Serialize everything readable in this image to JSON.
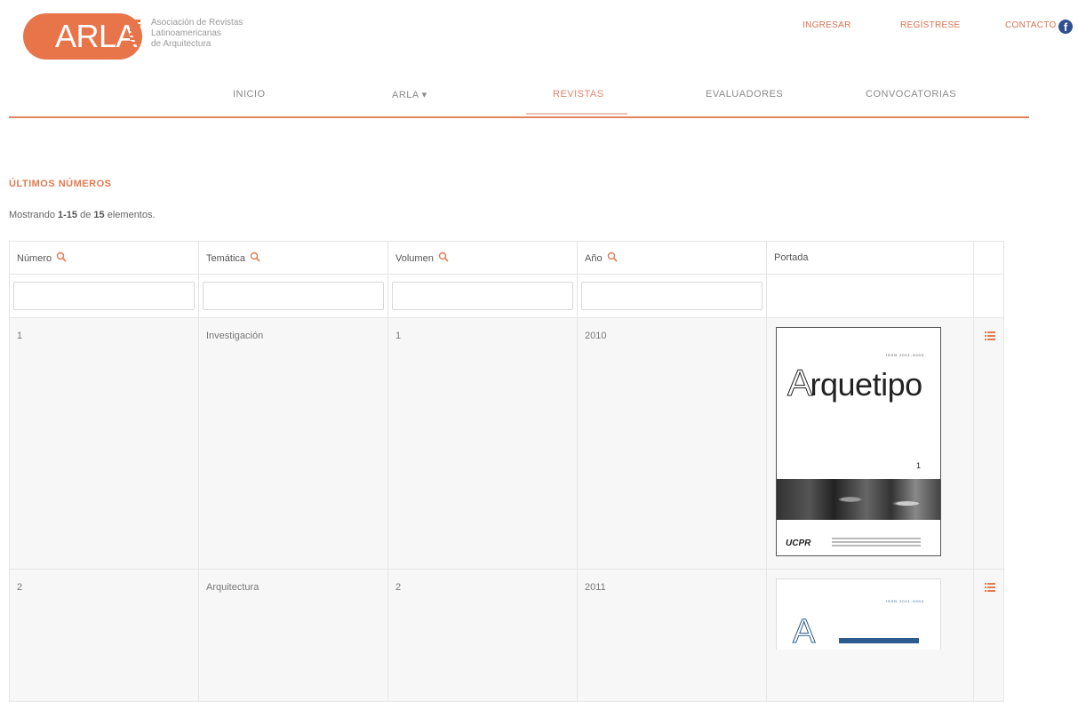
{
  "header": {
    "logo_text": "ARLA",
    "logo_subtitle": "Asociación de Revistas\nLatinoamericanas\nde Arquitectura",
    "links": {
      "login": "INGRESAR",
      "register": "REGÍSTRESE",
      "contact": "CONTACTO"
    },
    "facebook_icon": "facebook-icon"
  },
  "nav": {
    "items": [
      "INICIO",
      "ARLA ▾",
      "REVISTAS",
      "EVALUADORES",
      "CONVOCATORIAS"
    ],
    "active": "REVISTAS"
  },
  "section": {
    "title": "ÚLTIMOS NÚMEROS",
    "summary_prefix": "Mostrando ",
    "summary_range": "1-15",
    "summary_mid": " de ",
    "summary_total": "15",
    "summary_suffix": " elementos."
  },
  "table": {
    "columns": [
      "Número",
      "Temática",
      "Volumen",
      "Año",
      "Portada"
    ],
    "rows": [
      {
        "numero": "1",
        "tematica": "Investigación",
        "volumen": "1",
        "anio": "2010",
        "cover": {
          "title_initial": "A",
          "title_rest": "rquetipo",
          "issue": "1",
          "publisher": "UCPR"
        }
      },
      {
        "numero": "2",
        "tematica": "Arquitectura",
        "volumen": "2",
        "anio": "2011",
        "cover": {
          "title_initial": "A"
        }
      }
    ]
  },
  "colors": {
    "accent": "#e2855c",
    "link": "#d9724f",
    "facebook": "#2f4f8f"
  }
}
